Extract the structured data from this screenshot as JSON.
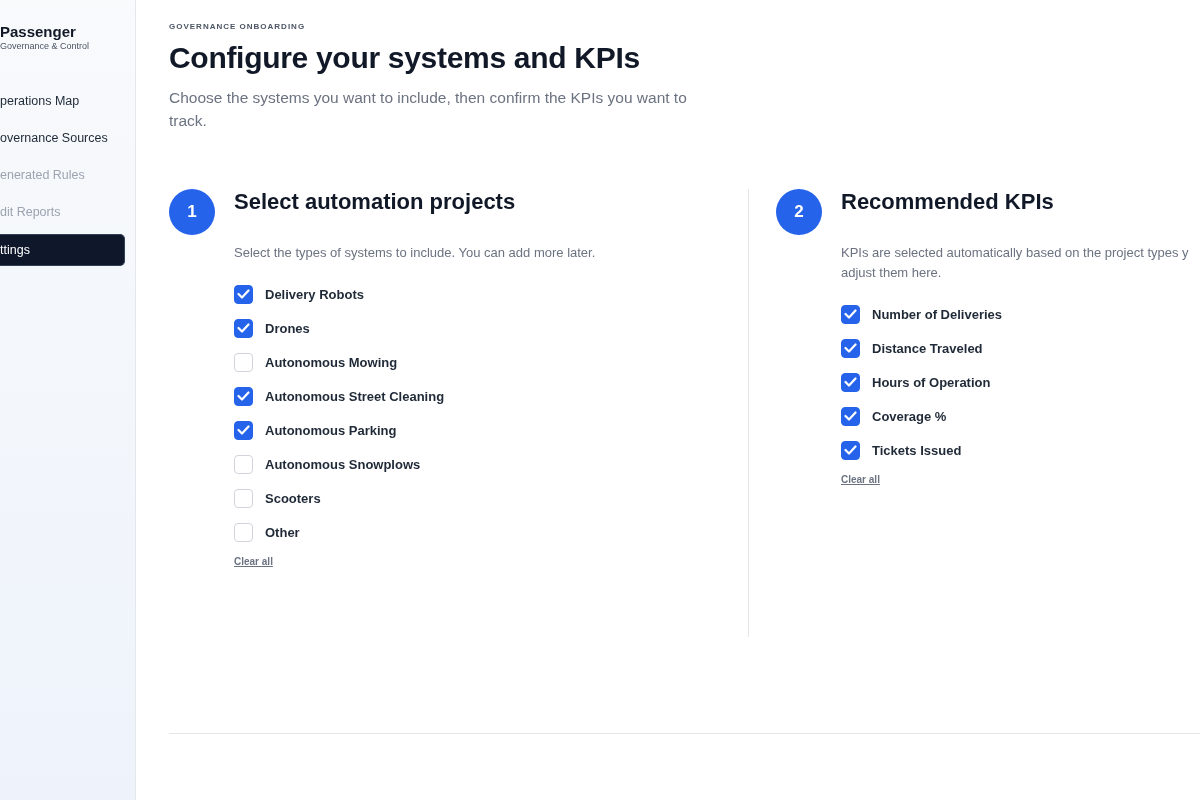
{
  "sidebar": {
    "brand": "Passenger",
    "tagline": "Governance & Control",
    "items": [
      {
        "label": "perations Map",
        "selected": false,
        "disabled": false
      },
      {
        "label": "overnance Sources",
        "selected": false,
        "disabled": false
      },
      {
        "label": "enerated Rules",
        "selected": false,
        "disabled": true
      },
      {
        "label": "dit Reports",
        "selected": false,
        "disabled": true
      },
      {
        "label": "ttings",
        "selected": true,
        "disabled": false
      }
    ]
  },
  "header": {
    "eyebrow": "GOVERNANCE ONBOARDING",
    "title": "Configure your systems and KPIs",
    "subtitle": "Choose the systems you want to include, then confirm the KPIs you want to track."
  },
  "steps": [
    {
      "number": "1",
      "title": "Select automation projects",
      "description_lines": [
        "Select the types of systems to include. You can add more later."
      ],
      "options": [
        {
          "label": "Delivery Robots",
          "checked": true
        },
        {
          "label": "Drones",
          "checked": true
        },
        {
          "label": "Autonomous Mowing",
          "checked": false
        },
        {
          "label": "Autonomous Street Cleaning",
          "checked": true
        },
        {
          "label": "Autonomous Parking",
          "checked": true
        },
        {
          "label": "Autonomous Snowplows",
          "checked": false
        },
        {
          "label": "Scooters",
          "checked": false
        },
        {
          "label": "Other",
          "checked": false
        }
      ],
      "clear_link": "Clear all"
    },
    {
      "number": "2",
      "title": "Recommended KPIs",
      "description_lines": [
        "KPIs are selected automatically based on the project types y",
        "adjust them here."
      ],
      "options": [
        {
          "label": "Number of Deliveries",
          "checked": true
        },
        {
          "label": "Distance Traveled",
          "checked": true
        },
        {
          "label": "Hours of Operation",
          "checked": true
        },
        {
          "label": "Coverage %",
          "checked": true
        },
        {
          "label": "Tickets Issued",
          "checked": true
        }
      ],
      "clear_link": "Clear all"
    }
  ]
}
